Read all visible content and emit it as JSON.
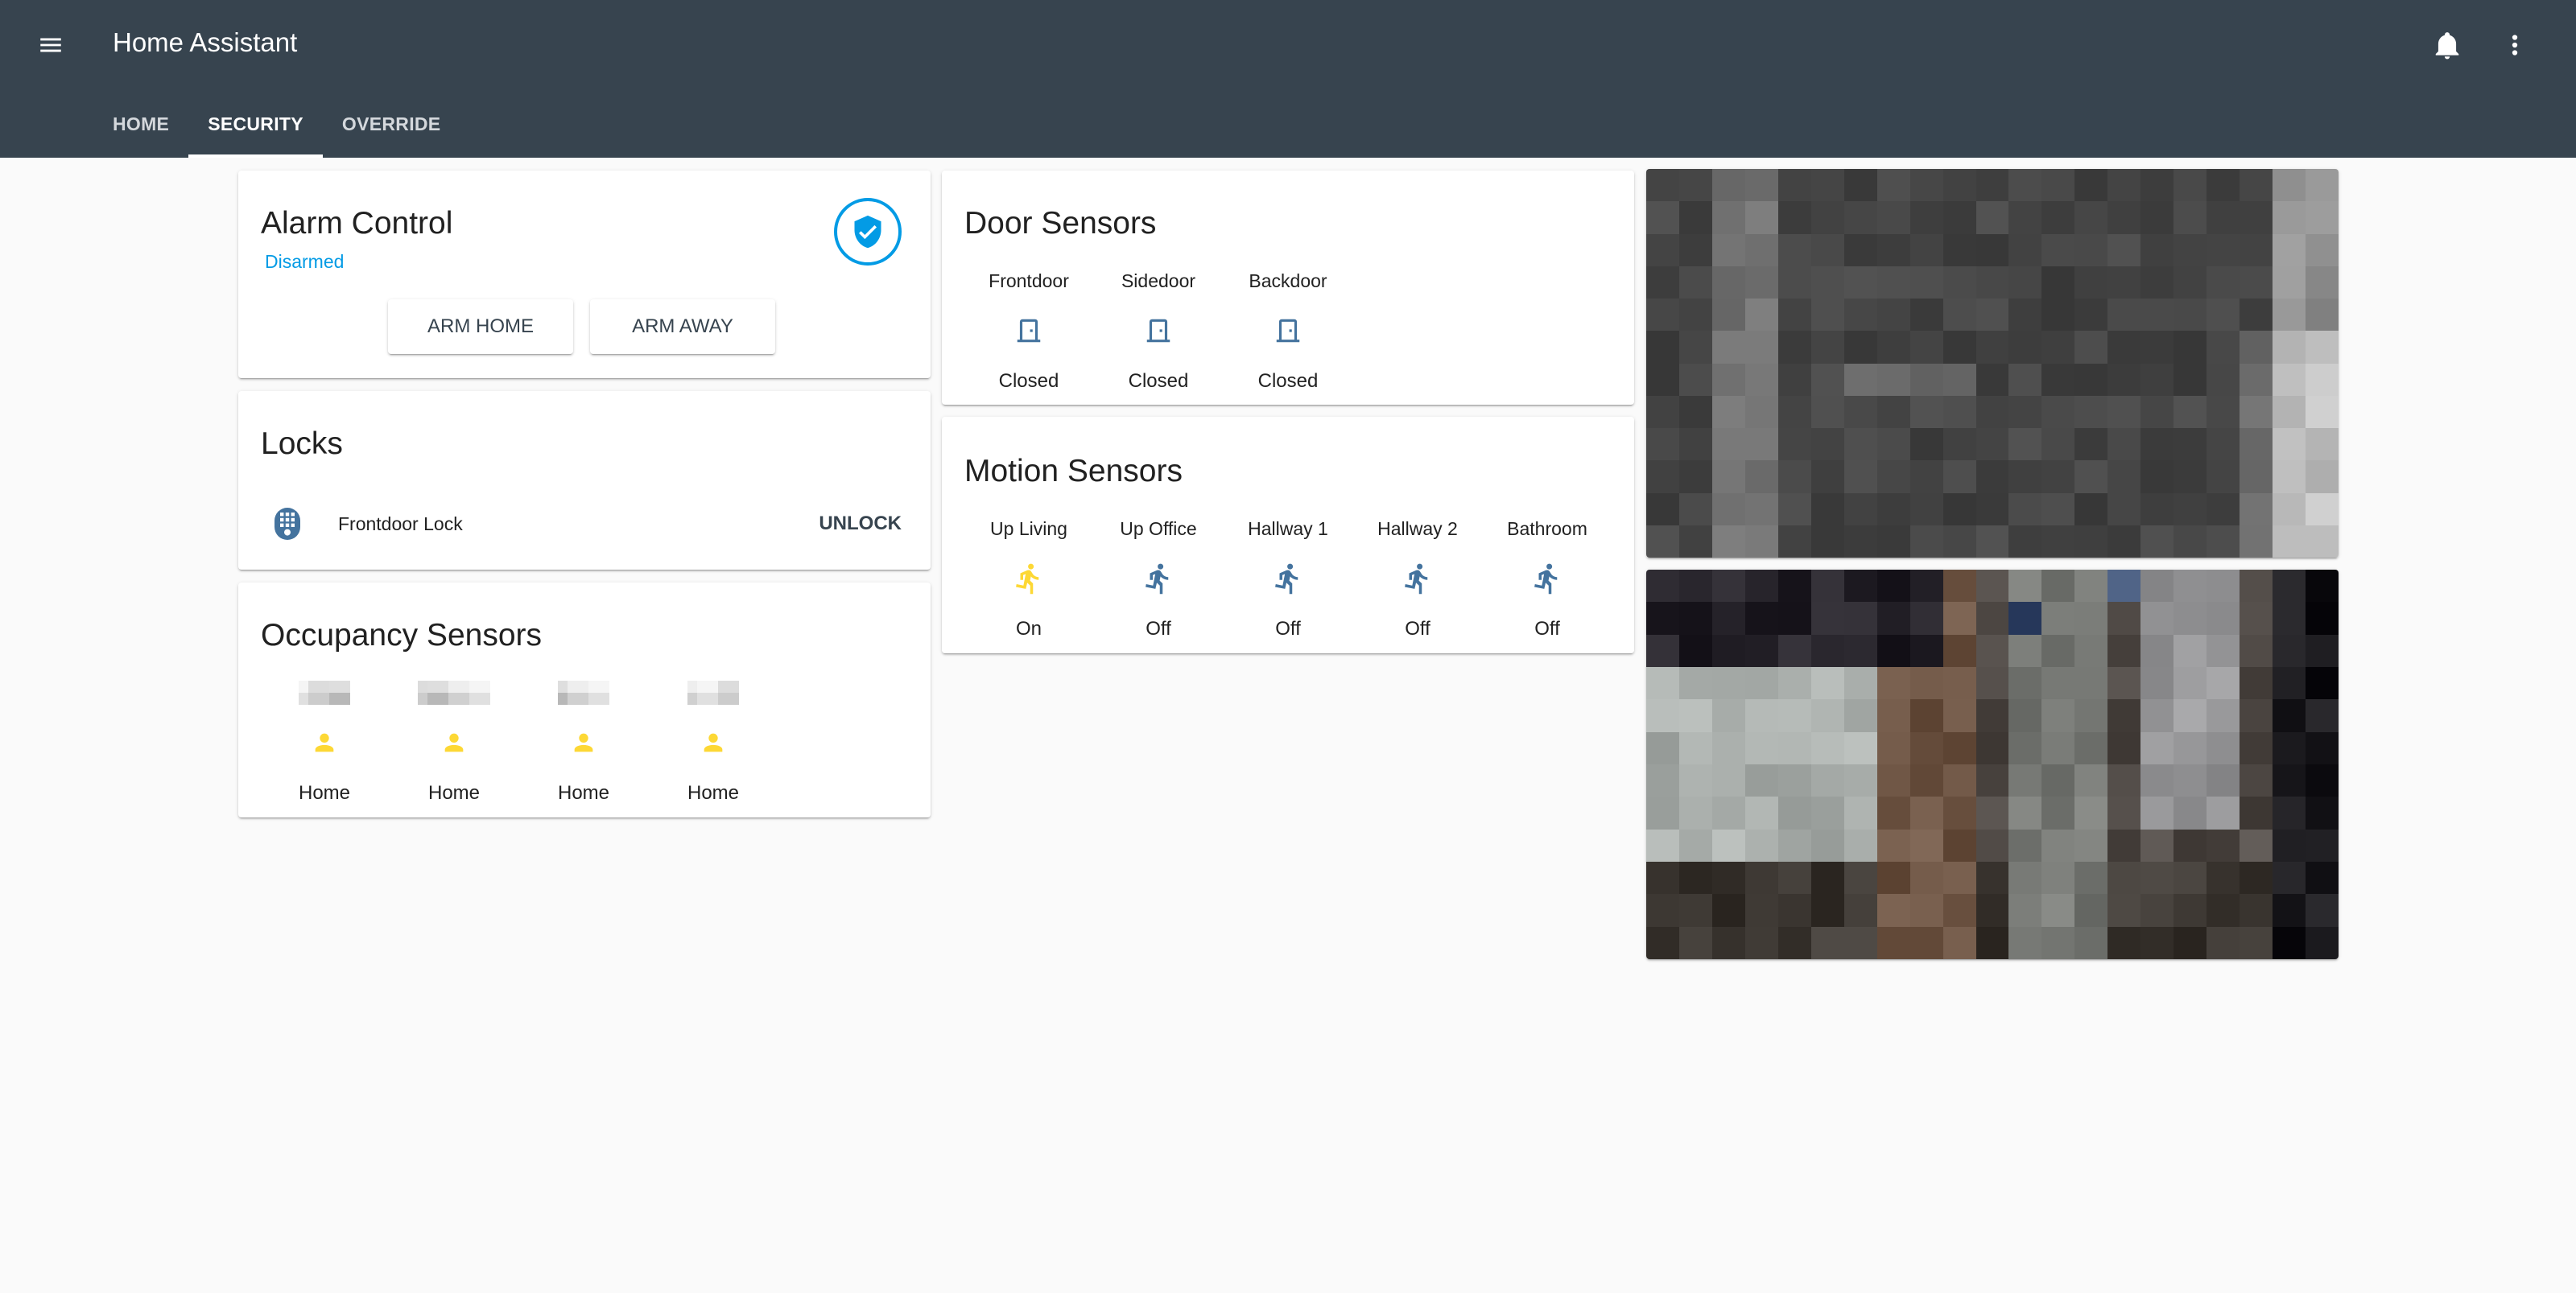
{
  "app": {
    "title": "Home Assistant",
    "icons": {
      "menu": "hamburger-menu-icon",
      "notifications": "bell-icon",
      "more": "dots-vertical-icon"
    }
  },
  "tabs": [
    {
      "label": "HOME",
      "active": false
    },
    {
      "label": "SECURITY",
      "active": true
    },
    {
      "label": "OVERRIDE",
      "active": false
    }
  ],
  "colors": {
    "header": "#37444f",
    "accent": "#039be5",
    "icon_off": "#44739e",
    "icon_on": "#fdd835",
    "background": "#fafafa"
  },
  "alarm": {
    "title": "Alarm Control",
    "state": "Disarmed",
    "icon": "shield-check-icon",
    "buttons": [
      "ARM HOME",
      "ARM AWAY"
    ]
  },
  "locks": {
    "title": "Locks",
    "items": [
      {
        "name": "Frontdoor Lock",
        "icon": "lock-keypad-icon",
        "action": "UNLOCK"
      }
    ]
  },
  "occupancy": {
    "title": "Occupancy Sensors",
    "items": [
      {
        "name": "[redacted]",
        "icon": "account-icon",
        "state": "Home"
      },
      {
        "name": "[redacted]",
        "icon": "account-icon",
        "state": "Home"
      },
      {
        "name": "[redacted]",
        "icon": "account-icon",
        "state": "Home"
      },
      {
        "name": "[redacted]",
        "icon": "account-icon",
        "state": "Home"
      }
    ]
  },
  "doors": {
    "title": "Door Sensors",
    "items": [
      {
        "name": "Frontdoor",
        "icon": "door-closed-icon",
        "state": "Closed"
      },
      {
        "name": "Sidedoor",
        "icon": "door-closed-icon",
        "state": "Closed"
      },
      {
        "name": "Backdoor",
        "icon": "door-closed-icon",
        "state": "Closed"
      }
    ]
  },
  "motion": {
    "title": "Motion Sensors",
    "items": [
      {
        "name": "Up Living",
        "icon": "run-icon",
        "state": "On",
        "active": true
      },
      {
        "name": "Up Office",
        "icon": "run-icon",
        "state": "Off",
        "active": false
      },
      {
        "name": "Hallway 1",
        "icon": "run-icon",
        "state": "Off",
        "active": false
      },
      {
        "name": "Hallway 2",
        "icon": "run-icon",
        "state": "Off",
        "active": false
      },
      {
        "name": "Bathroom",
        "icon": "run-icon",
        "state": "Off",
        "active": false
      }
    ]
  },
  "cameras": [
    {
      "name": "camera-feed-1",
      "content": "pixelated/obscured image"
    },
    {
      "name": "camera-feed-2",
      "content": "pixelated/obscured image"
    }
  ]
}
